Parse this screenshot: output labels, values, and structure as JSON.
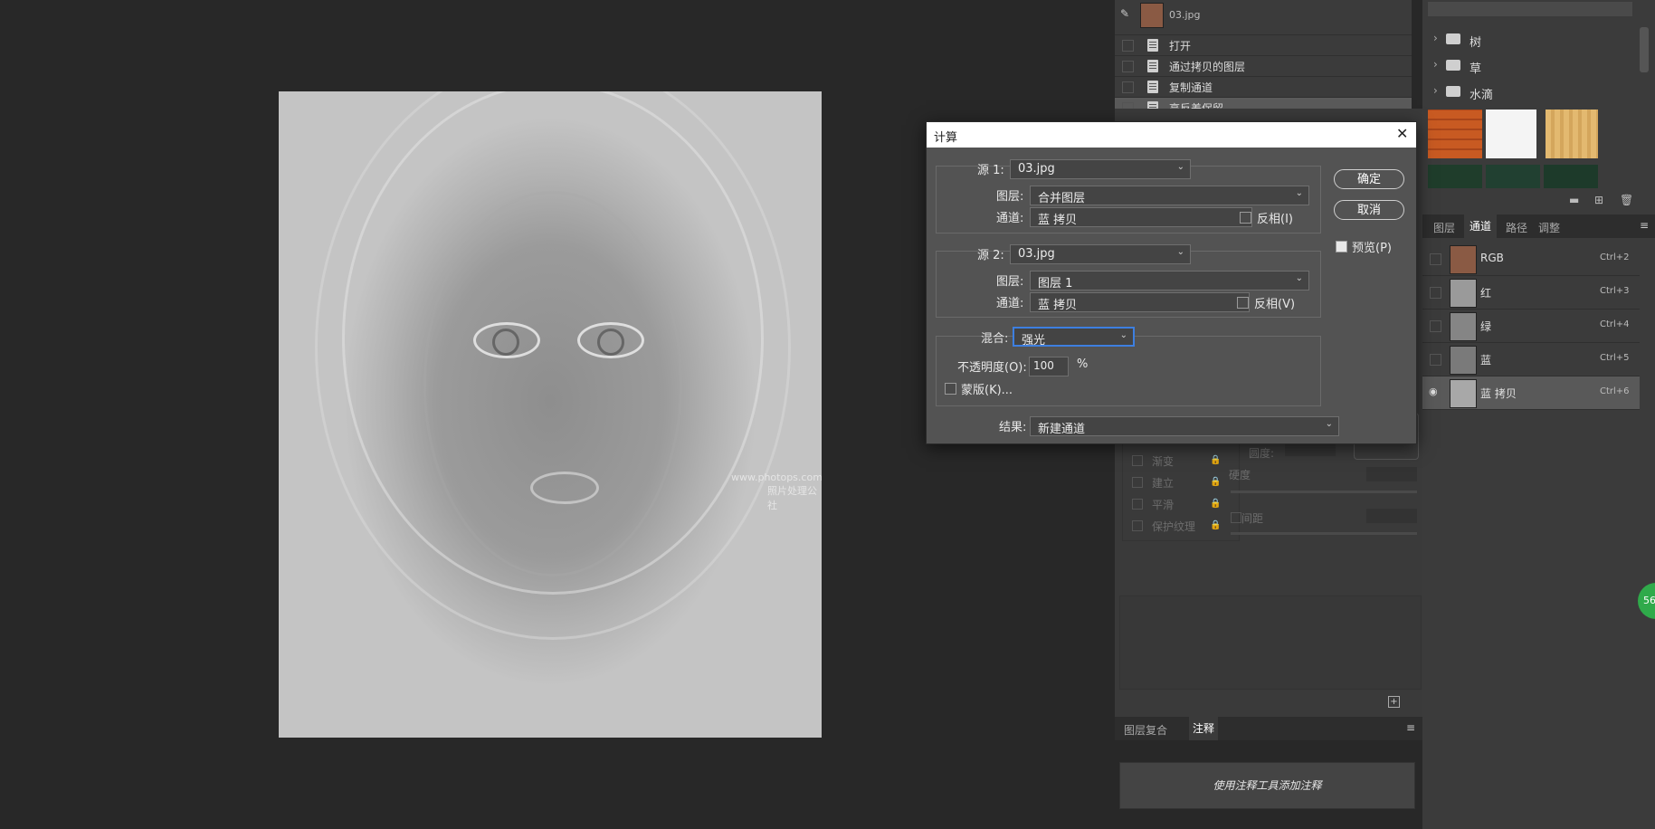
{
  "history": {
    "snapshot": "03.jpg",
    "items": [
      "打开",
      "通过拷贝的图层",
      "复制通道",
      "高反差保留"
    ]
  },
  "swatches": {
    "folders": [
      "树",
      "草",
      "水滴"
    ]
  },
  "channels_panel": {
    "tabs": [
      "图层",
      "通道",
      "路径",
      "调整"
    ],
    "active_tab": "通道",
    "channels": [
      {
        "name": "RGB",
        "shortcut": "Ctrl+2"
      },
      {
        "name": "红",
        "shortcut": "Ctrl+3"
      },
      {
        "name": "绿",
        "shortcut": "Ctrl+4"
      },
      {
        "name": "蓝",
        "shortcut": "Ctrl+5"
      },
      {
        "name": "蓝 拷贝",
        "shortcut": "Ctrl+6"
      }
    ]
  },
  "brush_panel": {
    "options": [
      "渐变",
      "建立",
      "平滑",
      "保护纹理"
    ],
    "hardness_label": "硬度",
    "spacing_label": "间距",
    "roundness_label": "圆度:"
  },
  "notes_panel": {
    "tabs": [
      "图层复合",
      "注释"
    ],
    "active_tab": "注释",
    "hint": "使用注释工具添加注释"
  },
  "dialog": {
    "title": "计算",
    "source1": {
      "label": "源 1:",
      "file": "03.jpg",
      "layer_label": "图层:",
      "layer": "合并图层",
      "channel_label": "通道:",
      "channel": "蓝 拷贝",
      "invert_label": "反相(I)"
    },
    "source2": {
      "label": "源 2:",
      "file": "03.jpg",
      "layer_label": "图层:",
      "layer": "图层 1",
      "channel_label": "通道:",
      "channel": "蓝 拷贝",
      "invert_label": "反相(V)"
    },
    "blend": {
      "label": "混合:",
      "mode": "强光",
      "opacity_label": "不透明度(O):",
      "opacity": "100",
      "unit": "%",
      "mask_label": "蒙版(K)..."
    },
    "result": {
      "label": "结果:",
      "value": "新建通道"
    },
    "ok_label": "确定",
    "cancel_label": "取消",
    "preview_label": "预览(P)",
    "preview_checked": true
  },
  "watermark": {
    "line1": "www.photops.com",
    "line2": "照片处理公社"
  },
  "badge": "56"
}
